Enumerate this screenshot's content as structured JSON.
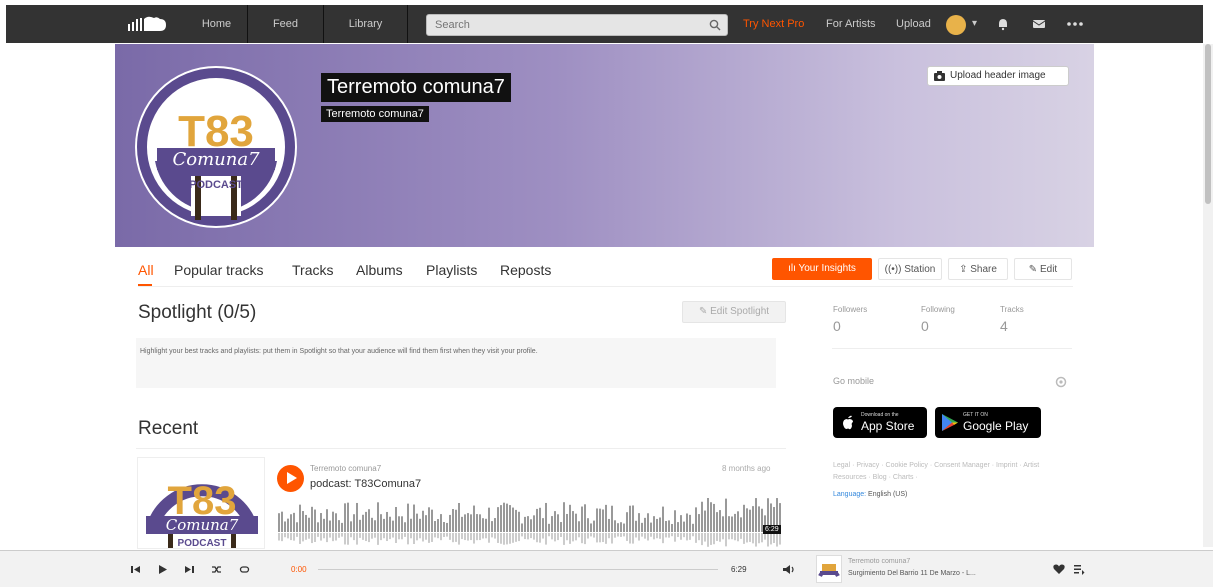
{
  "nav": {
    "home": "Home",
    "feed": "Feed",
    "library": "Library",
    "search_placeholder": "Search",
    "try_pro": "Try Next Pro",
    "for_artists": "For Artists",
    "upload": "Upload"
  },
  "header": {
    "name": "Terremoto comuna7",
    "subname": "Terremoto comuna7",
    "upload_header_image": "Upload header image",
    "avatar_art_lines": [
      "T83",
      "Comuna7",
      "PODCAST"
    ]
  },
  "tabs": [
    "All",
    "Popular tracks",
    "Tracks",
    "Albums",
    "Playlists",
    "Reposts"
  ],
  "actions": {
    "insights": "Your Insights",
    "station": "Station",
    "share": "Share",
    "edit": "Edit"
  },
  "spotlight": {
    "title": "Spotlight (0/5)",
    "edit_button": "Edit Spotlight",
    "description": "Highlight your best tracks and playlists: put them in Spotlight so that your audience will find them first when they visit your profile."
  },
  "recent": {
    "title": "Recent",
    "track": {
      "user": "Terremoto comuna7",
      "title": "podcast: T83Comuna7",
      "age": "8 months ago",
      "duration": "6:29",
      "art_lines": [
        "T83",
        "Comuna7",
        "PODCAST"
      ]
    }
  },
  "stats": {
    "followers_label": "Followers",
    "followers": "0",
    "following_label": "Following",
    "following": "0",
    "tracks_label": "Tracks",
    "tracks": "4"
  },
  "sidebar": {
    "go_mobile": "Go mobile",
    "appstore_small": "Download on the",
    "appstore_big": "App Store",
    "gplay_small": "GET IT ON",
    "gplay_big": "Google Play",
    "legal": "Legal · Privacy · Cookie Policy · Consent Manager · Imprint · Artist Resources · Blog · Charts ·",
    "language_label": "Language:",
    "language": "English (US)"
  },
  "player": {
    "current_time": "0:00",
    "total_time": "6:29",
    "user": "Terremoto comuna7",
    "title": "Surgimiento Del Barrio 11 De Marzo - L..."
  },
  "colors": {
    "accent": "#ff5500",
    "topbar": "#333333"
  }
}
